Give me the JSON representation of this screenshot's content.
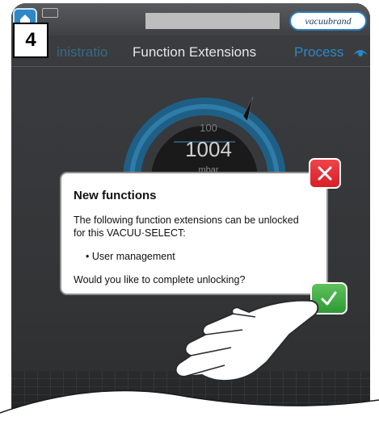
{
  "step": {
    "number": "4"
  },
  "header": {
    "logo_text": "vacuubrand",
    "icons": [
      "home-icon",
      "keypad-icon"
    ]
  },
  "tabs": {
    "left": "inistratio",
    "center": "Function Extensions",
    "right": "Process"
  },
  "gauge": {
    "setpoint": "100",
    "value": "1004",
    "unit": "mbar"
  },
  "dialog": {
    "title": "New functions",
    "text": "The following function extensions can be unlocked for this VACUU·SELECT:",
    "item": "• User management",
    "question": "Would you like to complete unlocking?",
    "close_icon": "close-icon",
    "confirm_icon": "checkmark-icon"
  },
  "colors": {
    "accent": "#2a87c9",
    "close": "#e0262d",
    "confirm": "#3aa53d",
    "background": "#3a3b3d"
  }
}
